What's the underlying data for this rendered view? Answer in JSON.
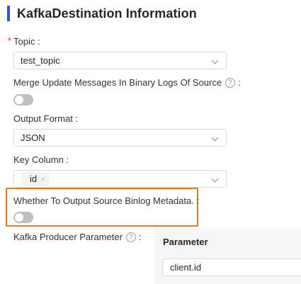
{
  "section": {
    "title": "KafkaDestination Information"
  },
  "topic": {
    "required_mark": "*",
    "label": "Topic :",
    "value": "test_topic"
  },
  "merge_update": {
    "label": "Merge Update Messages In Binary Logs Of Source",
    "help_glyph": "?",
    "suffix": ":",
    "enabled": false
  },
  "output_format": {
    "label": "Output Format :",
    "value": "JSON"
  },
  "key_column": {
    "label": "Key Column :",
    "tags": [
      "id"
    ],
    "tag_close": "×"
  },
  "binlog_metadata": {
    "label": "Whether To Output Source Binlog Metadata. :",
    "enabled": false,
    "highlight_color": "#e07b24"
  },
  "producer_parameter": {
    "label": "Kafka Producer Parameter",
    "help_glyph": "?",
    "suffix": ":",
    "table_header": "Parameter",
    "rows": [
      {
        "parameter": "client.id"
      }
    ]
  },
  "colors": {
    "accent": "#2f54eb",
    "required": "#f5222d",
    "toggle_off": "#bfbfbf"
  }
}
